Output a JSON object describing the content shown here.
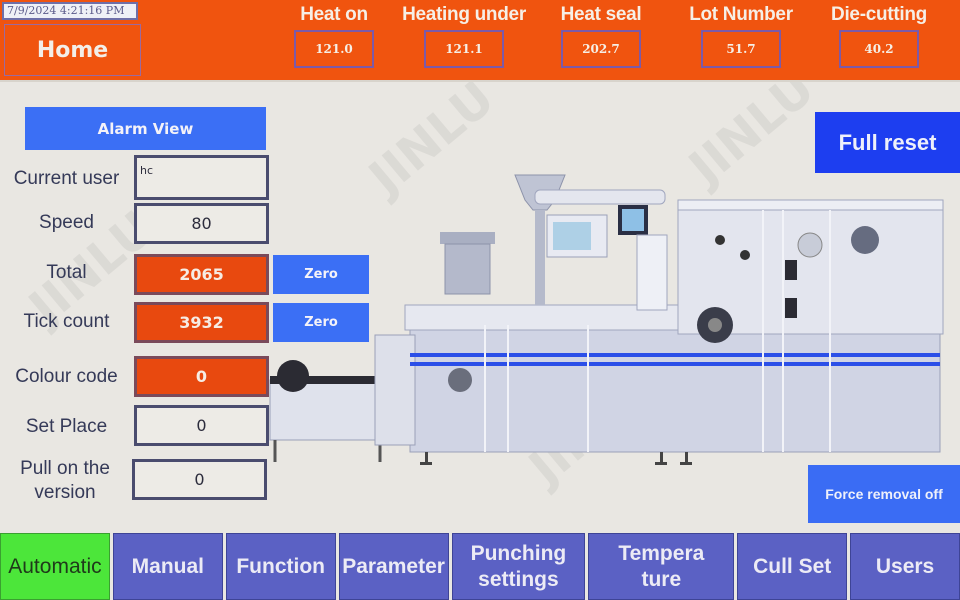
{
  "header": {
    "datetime": "7/9/2024 4:21:16 PM",
    "home_label": "Home",
    "readings": [
      {
        "label": "Heat on",
        "value": "121.0"
      },
      {
        "label": "Heating under",
        "value": "121.1"
      },
      {
        "label": "Heat seal",
        "value": "202.7"
      },
      {
        "label": "Lot Number",
        "value": "51.7"
      },
      {
        "label": "Die-cutting",
        "value": "40.2"
      }
    ]
  },
  "left_panel": {
    "alarm_view_label": "Alarm View",
    "current_user": {
      "label": "Current user",
      "value": "hc"
    },
    "speed": {
      "label": "Speed",
      "value": "80"
    },
    "total": {
      "label": "Total",
      "value": "2065",
      "zero_label": "Zero"
    },
    "tick_count": {
      "label": "Tick count",
      "value": "3932",
      "zero_label": "Zero"
    },
    "colour_code": {
      "label": "Colour code",
      "value": "0"
    },
    "set_place": {
      "label": "Set Place",
      "value": "0"
    },
    "pull_on_version": {
      "label": "Pull on the version",
      "value": "0"
    }
  },
  "right_panel": {
    "full_reset_label": "Full reset",
    "force_removal_label": "Force removal off"
  },
  "watermark": "JINLU",
  "nav": [
    {
      "label": "Automatic",
      "active": true
    },
    {
      "label": "Manual"
    },
    {
      "label": "Function"
    },
    {
      "label": "Parameter"
    },
    {
      "label": "Punching settings"
    },
    {
      "label": "Tempera ture"
    },
    {
      "label": "Cull Set"
    },
    {
      "label": "Users"
    }
  ],
  "colors": {
    "header_orange": "#f0540f",
    "button_blue": "#3b6ff5",
    "reset_blue": "#1d3ef0",
    "nav_purple": "#5b61c4",
    "active_green": "#4ce63a",
    "value_red": "#e8490f"
  }
}
